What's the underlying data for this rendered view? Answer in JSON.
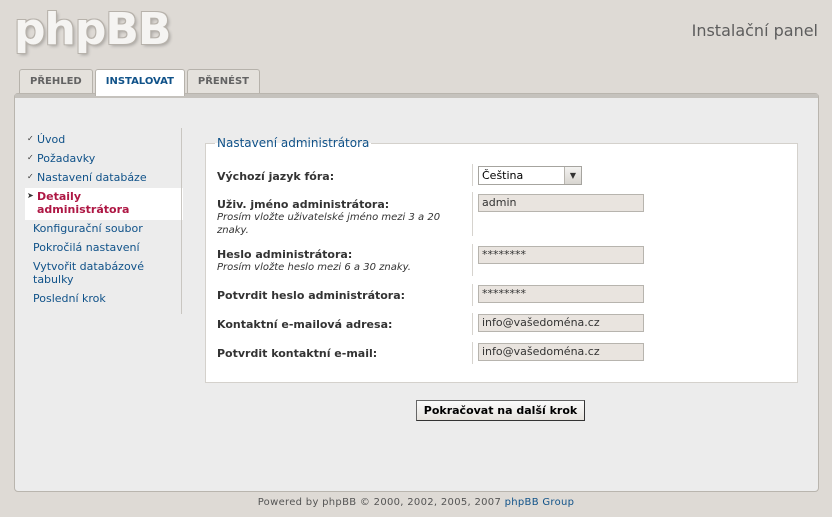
{
  "header": {
    "logo_text": "phpBB",
    "panel_title": "Instalační panel"
  },
  "tabs": [
    {
      "label": "PŘEHLED",
      "active": false
    },
    {
      "label": "INSTALOVAT",
      "active": true
    },
    {
      "label": "PŘENÉST",
      "active": false
    }
  ],
  "sidebar": {
    "items": [
      {
        "label": "Úvod",
        "state": "done"
      },
      {
        "label": "Požadavky",
        "state": "done"
      },
      {
        "label": "Nastavení databáze",
        "state": "done"
      },
      {
        "label": "Detaily administrátora",
        "state": "active"
      },
      {
        "label": "Konfigurační soubor",
        "state": "future"
      },
      {
        "label": "Pokročilá nastavení",
        "state": "future"
      },
      {
        "label": "Vytvořit databázové tabulky",
        "state": "future"
      },
      {
        "label": "Poslední krok",
        "state": "future"
      }
    ]
  },
  "form": {
    "legend": "Nastavení administrátora",
    "default_lang": {
      "label": "Výchozí jazyk fóra:",
      "value": "Čeština"
    },
    "admin_name": {
      "label": "Uživ. jméno administrátora:",
      "hint": "Prosím vložte uživatelské jméno mezi 3 a 20 znaky.",
      "value": "admin"
    },
    "admin_pass": {
      "label": "Heslo administrátora:",
      "hint": "Prosím vložte heslo mezi 6 a 30 znaky.",
      "value": "********"
    },
    "admin_pass_confirm": {
      "label": "Potvrdit heslo administrátora:",
      "value": "********"
    },
    "board_email": {
      "label": "Kontaktní e-mailová adresa:",
      "value": "info@vašedoména.cz"
    },
    "board_email_confirm": {
      "label": "Potvrdit kontaktní e-mail:",
      "value": "info@vašedoména.cz"
    },
    "submit_label": "Pokračovat na další krok"
  },
  "footer": {
    "text": "Powered by phpBB © 2000, 2002, 2005, 2007 ",
    "link": "phpBB Group"
  }
}
